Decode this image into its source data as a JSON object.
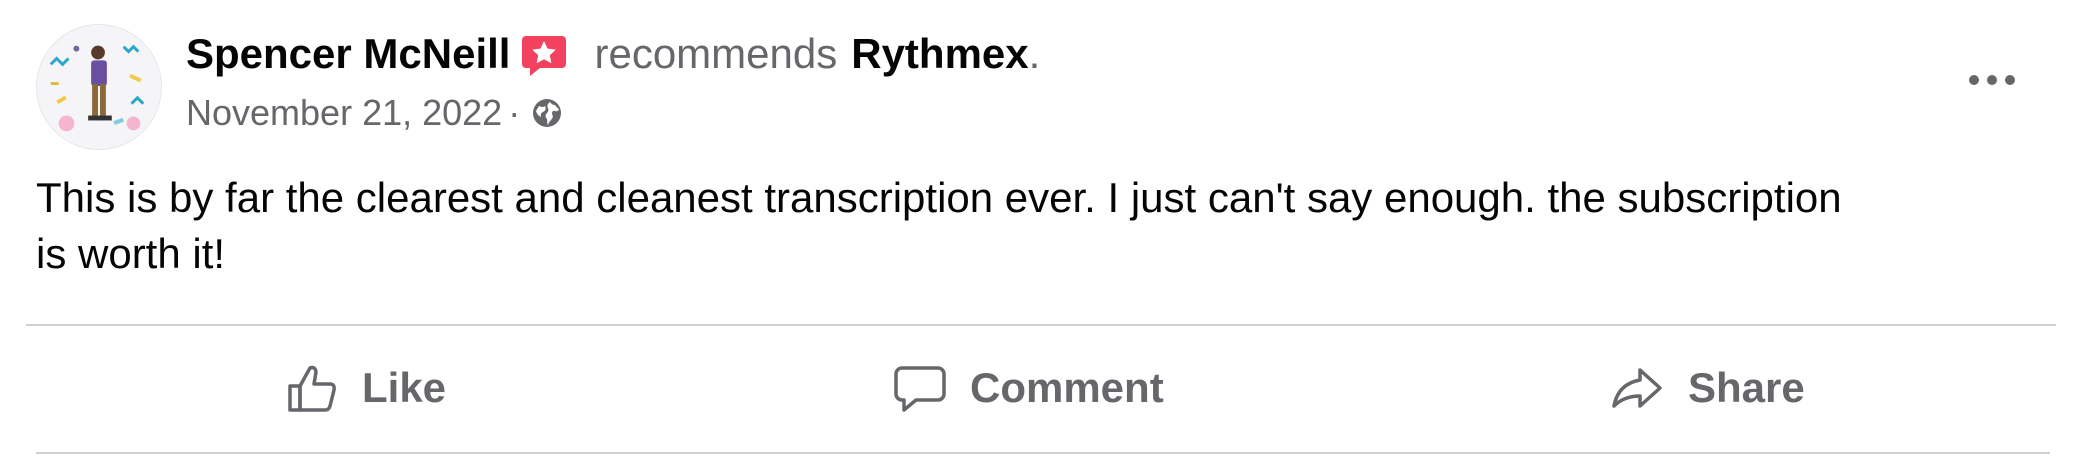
{
  "post": {
    "author": "Spencer McNeill",
    "verb": "recommends",
    "page": "Rythmex",
    "period": ".",
    "date": "November 21, 2022",
    "separator": "·",
    "audience_icon": "globe-icon",
    "badge_icon": "recommendation-star-icon",
    "more_icon": "more-options-icon",
    "body": "This is by far the clearest and cleanest transcription ever. I just can't say enough. the subscription\nis worth it!"
  },
  "actions": [
    {
      "label": "Like",
      "icon": "thumbs-up-icon"
    },
    {
      "label": "Comment",
      "icon": "comment-bubble-icon"
    },
    {
      "label": "Share",
      "icon": "share-arrow-icon"
    }
  ],
  "colors": {
    "text_primary": "#050505",
    "text_secondary": "#65676b",
    "divider": "#ced0d4",
    "recommend_badge": "#f3425f"
  }
}
